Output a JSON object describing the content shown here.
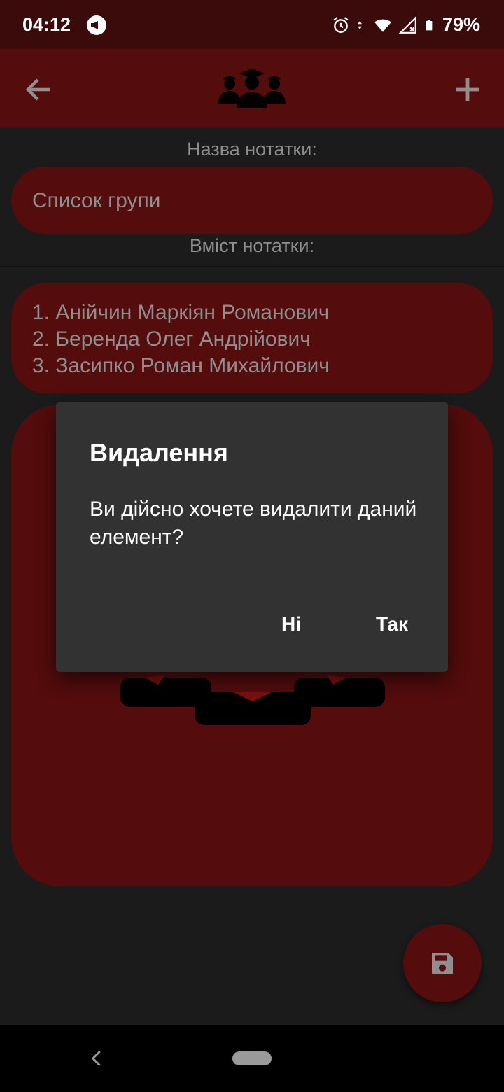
{
  "status_bar": {
    "time": "04:12",
    "battery": "79%",
    "icons": [
      "cast-icon",
      "alarm-icon",
      "data-arrows-icon",
      "wifi-icon",
      "signal-icon",
      "battery-icon"
    ]
  },
  "app_bar": {
    "back_icon": "arrow-left-icon",
    "logo_icon": "graduates-group-icon",
    "add_icon": "plus-icon"
  },
  "form": {
    "title_label": "Назва нотатки:",
    "title_value": "Список групи",
    "content_label": "Вміст нотатки:",
    "content_lines": [
      "1. Анійчин Маркіян Романович",
      "2. Беренда Олег Андрійович",
      "3. Засипко Роман Михайлович"
    ],
    "image_icon": "graduates-group-icon"
  },
  "dialog": {
    "title": "Видалення",
    "message": "Ви дійсно хочете видалити даний елемент?",
    "negative": "Ні",
    "positive": "Так"
  },
  "fab": {
    "icon": "save-icon"
  },
  "nav": {
    "back_icon": "chevron-left-icon",
    "home_icon": "home-pill-icon"
  },
  "colors": {
    "status_bar": "#3b0b0b",
    "app_bar": "#540c0c",
    "field": "#540c0c",
    "background": "#1b1b1b",
    "dialog": "#323232",
    "text_muted": "#8f8f8f"
  }
}
